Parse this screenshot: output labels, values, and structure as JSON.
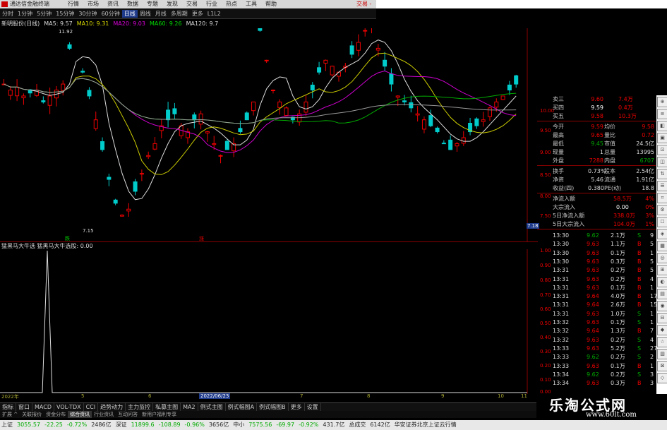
{
  "titlebar": {
    "app": "通达信金融终端",
    "menus": [
      "行情",
      "市场",
      "资讯",
      "数据",
      "专题",
      "发现",
      "交易",
      "行业",
      "热点",
      "工具",
      "帮助"
    ],
    "right": "交易 - ×"
  },
  "periodbar": {
    "items": [
      "分时",
      "1分钟",
      "5分钟",
      "15分钟",
      "30分钟",
      "60分钟",
      "日线",
      "周线",
      "月线",
      "多周期",
      "更多"
    ],
    "selected": "日线",
    "code": "L1L2"
  },
  "mabar": {
    "stock": "新明股份(日线)",
    "ma5": "MA5: 9.57",
    "ma10": "MA10: 9.31",
    "ma20": "MA20: 9.03",
    "ma60": "MA60: 9.26",
    "ma120": "MA120: 9.7"
  },
  "chart_data": {
    "type": "candlestick",
    "high_label": "11.92",
    "low_label": "7.15",
    "price_axis": [
      "10.00",
      "9.50",
      "9.00",
      "8.50",
      "8.00",
      "7.50"
    ],
    "last": "7.18",
    "markers": [
      "跌",
      "涨"
    ]
  },
  "subchart": {
    "title": "猛黑马大牛选 猛黑马大牛选股: 0.00",
    "axis": [
      "1.00",
      "0.90",
      "0.80",
      "0.70",
      "0.60",
      "0.50",
      "0.40",
      "0.30",
      "0.20",
      "0.10",
      "0.00"
    ]
  },
  "dates": {
    "d1": "2022/06/23",
    "y0": "2022年",
    "m": [
      "5",
      "6",
      "7",
      "8",
      "9",
      "10",
      "11"
    ]
  },
  "bottomtabs": [
    "指标",
    "窗口",
    "MACD",
    "VOL-TDX",
    "CCI",
    "趋势动力",
    "主力监控",
    "私募主图",
    "MA2",
    "例式主图",
    "例式幅图A",
    "例式幅图B",
    "更多",
    "设置"
  ],
  "navtabs": [
    "扩展 ^",
    "关联报价",
    "资金分布",
    "综合资讯",
    "行业资讯",
    "互动问答",
    "新用户福利专享"
  ],
  "quote": {
    "sell5": {
      "l": "卖三",
      "p": "9.60",
      "v": "7.4万"
    },
    "sell4": {
      "l": "买四",
      "p": "9.59",
      "v": "0.4万"
    },
    "sell3": {
      "l": "买五",
      "p": "9.58",
      "v": "10.3万"
    },
    "rows": [
      {
        "l": "今开",
        "v": "9.59",
        "l2": "均价",
        "v2": "9.58"
      },
      {
        "l": "最高",
        "v": "9.65",
        "l2": "量比",
        "v2": "0.72"
      },
      {
        "l": "最低",
        "v": "9.45",
        "l2": "市值",
        "v2": "24.5亿"
      },
      {
        "l": "现量",
        "v": "1",
        "l2": "总量",
        "v2": "13995"
      },
      {
        "l": "外盘",
        "v": "7288",
        "l2": "内盘",
        "v2": "6707"
      },
      {
        "l": "换手",
        "v": "0.73%",
        "l2": "股本",
        "v2": "2.54亿"
      },
      {
        "l": "净资",
        "v": "5.46",
        "l2": "流通",
        "v2": "1.91亿"
      },
      {
        "l": "收益(四)",
        "v": "0.380",
        "l2": "PE(动)",
        "v2": "18.8"
      }
    ],
    "flows": [
      {
        "l": "净流入额",
        "v": "58.5万",
        "p": "4%"
      },
      {
        "l": "大宗流入",
        "v": "0.00",
        "p": "0%"
      },
      {
        "l": "5日净流入额",
        "v": "338.0万",
        "p": "3%"
      },
      {
        "l": "5日大宗流入",
        "v": "104.0万",
        "p": "1%"
      }
    ]
  },
  "trades": [
    {
      "t": "13:30",
      "p": "9.62",
      "v": "2.1万",
      "d": "S",
      "n": "9"
    },
    {
      "t": "13:30",
      "p": "9.63",
      "v": "1.1万",
      "d": "B",
      "n": "5"
    },
    {
      "t": "13:30",
      "p": "9.63",
      "v": "0.1万",
      "d": "B",
      "n": "1"
    },
    {
      "t": "13:30",
      "p": "9.63",
      "v": "0.3万",
      "d": "B",
      "n": "5"
    },
    {
      "t": "13:31",
      "p": "9.63",
      "v": "0.2万",
      "d": "B",
      "n": "5"
    },
    {
      "t": "13:31",
      "p": "9.63",
      "v": "0.2万",
      "d": "B",
      "n": "4"
    },
    {
      "t": "13:31",
      "p": "9.63",
      "v": "0.1万",
      "d": "B",
      "n": "1"
    },
    {
      "t": "13:31",
      "p": "9.64",
      "v": "4.0万",
      "d": "B",
      "n": "17"
    },
    {
      "t": "13:31",
      "p": "9.64",
      "v": "2.6万",
      "d": "B",
      "n": "15"
    },
    {
      "t": "13:31",
      "p": "9.63",
      "v": "1.0万",
      "d": "S",
      "n": "1"
    },
    {
      "t": "13:32",
      "p": "9.63",
      "v": "0.1万",
      "d": "S",
      "n": "1"
    },
    {
      "t": "13:32",
      "p": "9.64",
      "v": "1.3万",
      "d": "B",
      "n": "7"
    },
    {
      "t": "13:32",
      "p": "9.63",
      "v": "0.2万",
      "d": "S",
      "n": "4"
    },
    {
      "t": "13:33",
      "p": "9.63",
      "v": "5.2万",
      "d": "S",
      "n": "27"
    },
    {
      "t": "13:33",
      "p": "9.62",
      "v": "0.2万",
      "d": "S",
      "n": "2"
    },
    {
      "t": "13:33",
      "p": "9.63",
      "v": "0.1万",
      "d": "B",
      "n": "1"
    },
    {
      "t": "13:34",
      "p": "9.62",
      "v": "0.2万",
      "d": "S",
      "n": "3"
    },
    {
      "t": "13:34",
      "p": "9.63",
      "v": "0.3万",
      "d": "B",
      "n": "3"
    }
  ],
  "status": {
    "sh": "上证",
    "shv": "3055.57",
    "shc": "-22.25",
    "shp": "-0.72%",
    "sha": "2486亿",
    "sz": "深证",
    "szv": "11899.6",
    "szc": "-108.89",
    "szp": "-0.96%",
    "sza": "3656亿",
    "zx": "中小",
    "zxv": "7575.56",
    "zxc": "-69.97",
    "zxp": "-0.92%",
    "zxa": "431.7亿",
    "total": "总成交",
    "totalv": "6142亿",
    "broker": "华安证券北京上证云行情"
  },
  "watermark": {
    "l1": "乐淘公式网",
    "l2": "www.60lt.com"
  }
}
